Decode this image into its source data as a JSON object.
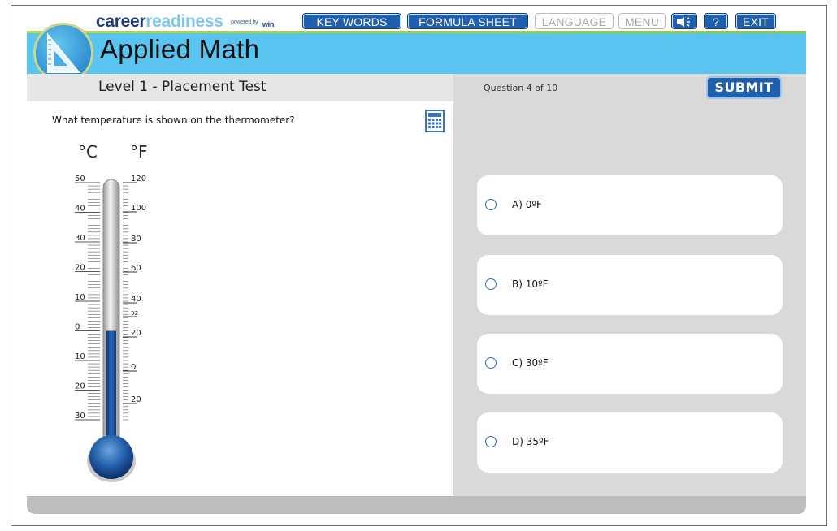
{
  "brand": {
    "part1": "career",
    "part2": "readiness",
    "powered": "powered by",
    "win": "win"
  },
  "nav": {
    "key_words": "KEY WORDS",
    "formula_sheet": "FORMULA SHEET",
    "language": "LANGUAGE",
    "menu": "MENU",
    "help": "?",
    "exit": "EXIT"
  },
  "header": {
    "title": "Applied Math",
    "level": "Level 1 - Placement Test",
    "question_count": "Question 4 of 10",
    "submit": "SUBMIT"
  },
  "question": {
    "text": "What temperature is shown on the thermometer?"
  },
  "thermometer": {
    "celsius_unit": "°C",
    "fahrenheit_unit": "°F",
    "celsius_labels": [
      "50",
      "40",
      "30",
      "20",
      "10",
      "0",
      "10",
      "20",
      "30"
    ],
    "fahrenheit_labels": [
      "120",
      "100",
      "80",
      "60",
      "40",
      "32",
      "20",
      "0",
      "20"
    ],
    "reading_celsius": 0
  },
  "options": [
    {
      "label": "A) 0ºF"
    },
    {
      "label": "B) 10ºF"
    },
    {
      "label": "C) 30ºF"
    },
    {
      "label": "D) 35ºF"
    }
  ],
  "colors": {
    "header_blue": "#58c4ef",
    "button_blue": "#1e5fae",
    "mercury": "#1c4f95"
  }
}
